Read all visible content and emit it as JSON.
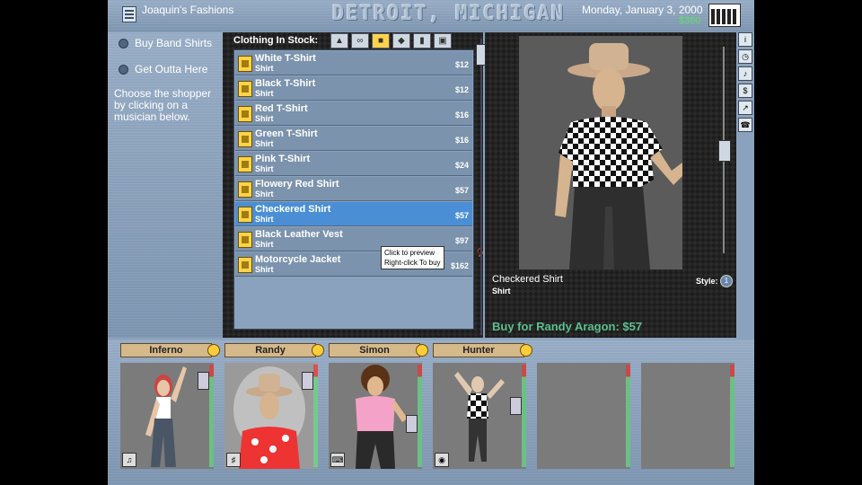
{
  "header": {
    "store_name": "Joaquin's Fashions",
    "city": "DETROIT, MICHIGAN",
    "date": "Monday, January 3, 2000",
    "money": "$360"
  },
  "sidebar": {
    "buttons": [
      {
        "label": "Buy Band Shirts"
      },
      {
        "label": "Get Outta Here"
      }
    ],
    "help_text": "Choose the shopper by clicking on a musician below."
  },
  "stock": {
    "label": "Clothing In Stock:",
    "categories": [
      "hat-icon",
      "glasses-icon",
      "shirt-icon",
      "shoe-icon",
      "pants-icon",
      "boots-icon"
    ],
    "items": [
      {
        "name": "White T-Shirt",
        "type": "Shirt",
        "price": "$12"
      },
      {
        "name": "Black T-Shirt",
        "type": "Shirt",
        "price": "$12"
      },
      {
        "name": "Red T-Shirt",
        "type": "Shirt",
        "price": "$16"
      },
      {
        "name": "Green T-Shirt",
        "type": "Shirt",
        "price": "$16"
      },
      {
        "name": "Pink T-Shirt",
        "type": "Shirt",
        "price": "$24"
      },
      {
        "name": "Flowery Red Shirt",
        "type": "Shirt",
        "price": "$57"
      },
      {
        "name": "Checkered Shirt",
        "type": "Shirt",
        "price": "$57",
        "selected": true
      },
      {
        "name": "Black Leather Vest",
        "type": "Shirt",
        "price": "$97"
      },
      {
        "name": "Motorcycle Jacket",
        "type": "Shirt",
        "price": "$162"
      }
    ],
    "tooltip_line1": "Click to preview",
    "tooltip_line2": "Right-click To buy"
  },
  "preview": {
    "item_name": "Checkered Shirt",
    "item_type": "Shirt",
    "style_label": "Style:",
    "style_value": "1",
    "buy_text": "Buy for Randy Aragon: $57"
  },
  "band": {
    "members": [
      {
        "name": "Inferno"
      },
      {
        "name": "Randy"
      },
      {
        "name": "Simon"
      },
      {
        "name": "Hunter"
      }
    ]
  }
}
